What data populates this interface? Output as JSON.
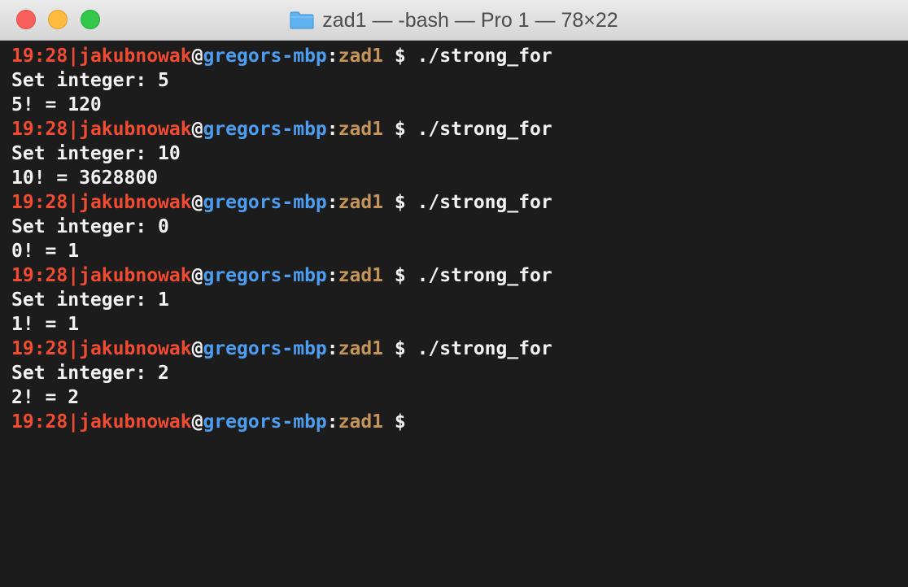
{
  "window": {
    "title": "zad1 — -bash — Pro 1 — 78×22",
    "title_icon": "folder-icon",
    "colors": {
      "background": "#1c1c1c",
      "prompt_user": "#f14b32",
      "prompt_host": "#4d9df0",
      "prompt_dir": "#c4955b",
      "text": "#f2f2f2"
    }
  },
  "prompt": {
    "time": "19:28",
    "separator": "|",
    "user": "jakubnowak",
    "at": "@",
    "host": "gregors-mbp",
    "colon": ":",
    "dir": "zad1",
    "dollar": " $ "
  },
  "lines": [
    {
      "type": "prompt",
      "command": "./strong_for"
    },
    {
      "type": "output",
      "text": "Set integer: 5"
    },
    {
      "type": "output",
      "text": "5! = 120"
    },
    {
      "type": "prompt",
      "command": "./strong_for"
    },
    {
      "type": "output",
      "text": "Set integer: 10"
    },
    {
      "type": "output",
      "text": "10! = 3628800"
    },
    {
      "type": "prompt",
      "command": "./strong_for"
    },
    {
      "type": "output",
      "text": "Set integer: 0"
    },
    {
      "type": "output",
      "text": "0! = 1"
    },
    {
      "type": "prompt",
      "command": "./strong_for"
    },
    {
      "type": "output",
      "text": "Set integer: 1"
    },
    {
      "type": "output",
      "text": "1! = 1"
    },
    {
      "type": "prompt",
      "command": "./strong_for"
    },
    {
      "type": "output",
      "text": "Set integer: 2"
    },
    {
      "type": "output",
      "text": "2! = 2"
    },
    {
      "type": "prompt",
      "command": ""
    }
  ]
}
